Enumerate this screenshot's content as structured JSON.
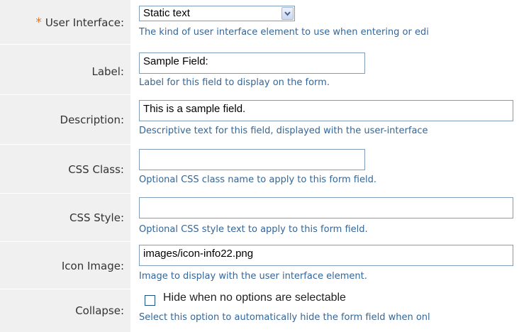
{
  "fields": {
    "user_interface": {
      "required_mark": "*",
      "label": "User Interface:",
      "selected": "Static text",
      "help": "The kind of user interface element to use when entering or edi"
    },
    "label": {
      "label": "Label:",
      "value": "Sample Field:",
      "help": "Label for this field to display on the form."
    },
    "description": {
      "label": "Description:",
      "value": "This is a sample field.",
      "help": "Descriptive text for this field, displayed with the user-interface"
    },
    "css_class": {
      "label": "CSS Class:",
      "value": "",
      "help": "Optional CSS class name to apply to this form field."
    },
    "css_style": {
      "label": "CSS Style:",
      "value": "",
      "help": "Optional CSS style text to apply to this form field."
    },
    "icon_image": {
      "label": "Icon Image:",
      "value": "images/icon-info22.png",
      "help": "Image to display with the user interface element."
    },
    "collapse": {
      "label": "Collapse:",
      "checkbox_label": "Hide when no options are selectable",
      "checked": false,
      "help": "Select this option to automatically hide the form field when onl"
    }
  },
  "colors": {
    "label_background": "#f0f0f0",
    "help_text": "#336699",
    "required_star": "#e8731e",
    "input_border": "#7f9db9"
  },
  "icons": {
    "select_arrow": "chevron-down-icon"
  }
}
